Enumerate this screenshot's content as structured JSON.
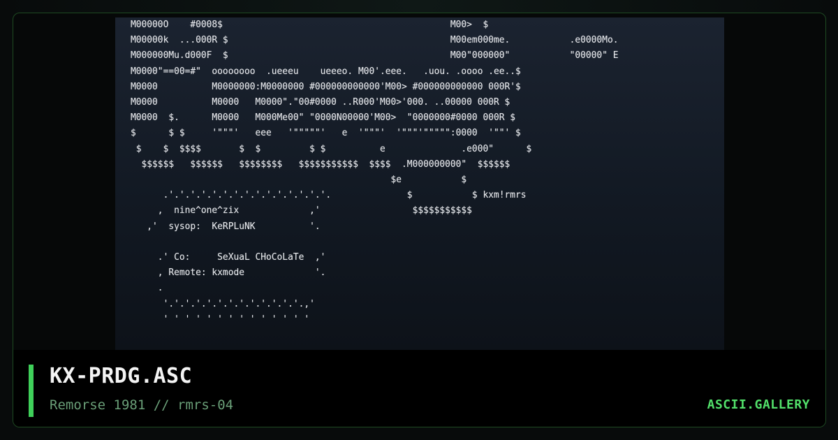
{
  "artwork": {
    "ascii": "M00000O    #0008$                                          M00>  $\nM00000k  ...000R $                                         M00em000me.           .e0000Mo.\nM000000Mu.d000F  $                                         M00\"000000\"           \"00000\" E\nM0000\"==00=#\"  oooooooo  .ueeeu    ueeeo. M00'.eee.   .uou. .oooo .ee..$\nM0000          M0000000:M0000000 #000000000000'M00> #000000000000 000R'$\nM0000          M0000   M0000\".\"00#0000 ..R000'M00>'000. ..00000 000R $\nM0000  $.      M0000   M000Me00\" \"0000N00000'M00>  \"0000000#0000 000R $\n$      $ $     '\"\"\"'   eee   '\"\"\"\"\"'   e  '\"\"\"'  '\"\"\"'\"\"\"\"\":0000  '\"\"' $\n $    $  $$$$       $  $         $ $          e              .e000\"      $\n  $$$$$$   $$$$$$   $$$$$$$$   $$$$$$$$$$$  $$$$  .M000000000\"  $$$$$$\n                                                $e           $\n      .'.'.'.'.'.'.'.'.'.'.'.'.'.'.'.              $           $ kxm!rmrs\n     ,  nine^one^zix             ,'                 $$$$$$$$$$$\n   ,'  sysop:  KeRPLuNK          '.\n\n     .' Co:     SeXuaL CHoCoLaTe  ,'\n     , Remote: kxmode             '.\n     .\n      '.'.'.'.'.'.'.'.'.'.'.'.'.,'\n      ' ' ' ' ' ' ' ' ' ' ' ' ' '"
  },
  "footer": {
    "title": "KX-PRDG.ASC",
    "subtitle": "Remorse 1981 // rmrs-04",
    "brand": "ASCII.GALLERY"
  },
  "colors": {
    "accent": "#3fd05a",
    "brand": "#52e06a",
    "subtitle": "#6a9f78",
    "frame_border": "#1e4a22"
  }
}
